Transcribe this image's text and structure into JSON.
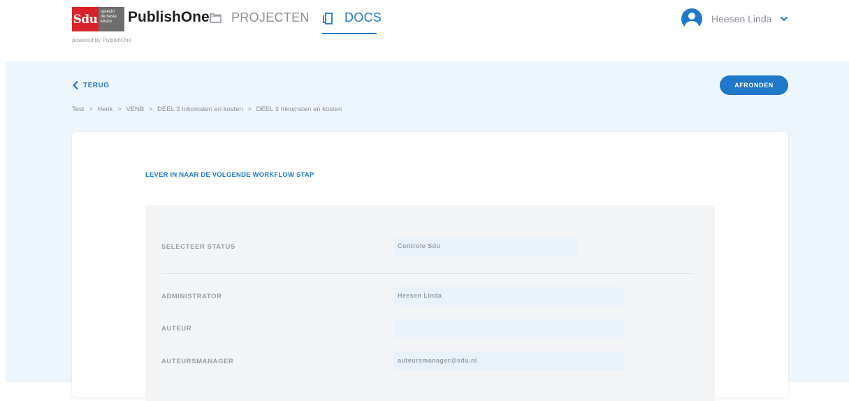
{
  "logo": {
    "text": "Sdu",
    "tagline": [
      "oprecht",
      "de beste",
      "keuze"
    ],
    "colors": {
      "red": "#d8232a",
      "grey": "#6e6e6e"
    }
  },
  "brand": "PublishOne",
  "powered_by": "powered by PublishOne",
  "nav": {
    "items": [
      {
        "label": "PROJECTEN",
        "icon": "folder-icon",
        "active": false
      },
      {
        "label": "DOCS",
        "icon": "documents-icon",
        "active": true
      }
    ]
  },
  "user": {
    "name": "Heesen Linda",
    "icon": "user-avatar-icon"
  },
  "page": {
    "back_label": "TERUG",
    "finish_label": "AFRONDEN",
    "breadcrumb": [
      "Test",
      "Henk",
      "VENB",
      "DEEL 3 Inkomsten en kosten",
      "DEEL 3 Inkomsten en kosten"
    ],
    "breadcrumb_separator": ">"
  },
  "form": {
    "title": "LEVER IN NAAR DE VOLGENDE WORKFLOW STAP",
    "status": {
      "label": "SELECTEER STATUS",
      "value": "Controle Sdu"
    },
    "administrator": {
      "label": "ADMINISTRATOR",
      "value": "Heesen Linda"
    },
    "auteur": {
      "label": "AUTEUR",
      "value": ""
    },
    "auteursmanager": {
      "label": "AUTEURSMANAGER",
      "value": "auteursmanager@sdu.nl"
    }
  },
  "colors": {
    "accent": "#1f78c8",
    "background": "#eef6fd",
    "field": "#e9f2fb"
  }
}
